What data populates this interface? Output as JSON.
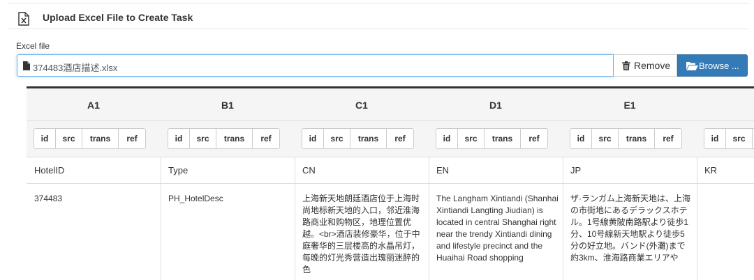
{
  "panel": {
    "title": "Upload Excel File to Create Task"
  },
  "form": {
    "label": "Excel file",
    "file_name": "374483酒店描述.xlsx",
    "remove_label": "Remove",
    "browse_label": "Browse ..."
  },
  "grid": {
    "segment_labels": {
      "id": "id",
      "src": "src",
      "trans": "trans",
      "ref": "ref"
    },
    "columns": [
      {
        "letter": "A1",
        "header": "HotelID",
        "value": "374483"
      },
      {
        "letter": "B1",
        "header": "Type",
        "value": "PH_HotelDesc"
      },
      {
        "letter": "C1",
        "header": "CN",
        "value": "上海新天地朗廷酒店位于上海时尚地标新天地的入口，邻近淮海路商业和购物区，地理位置优越。<br>酒店装修豪华，位于中庭奢华的三层楼高的水晶吊灯，每晚的灯光秀营造出瑰丽迷醉的色"
      },
      {
        "letter": "D1",
        "header": "EN",
        "value": "The Langham Xintiandi (Shanhai Xintiandi Langting Jiudian) is located in central Shanghai right near the trendy Xintiandi dining and lifestyle precinct and the Huaihai Road shopping"
      },
      {
        "letter": "E1",
        "header": "JP",
        "value": "ザ·ランガム上海新天地は、上海の市街地にあるデラックスホテル。1号線黄陂南路駅より徒歩1分、10号線新天地駅より徒歩5分の好立地。バンド(外灘)まで約3km、淮海路商業エリアや"
      },
      {
        "letter": "",
        "header": "KR",
        "value": ""
      }
    ]
  }
}
